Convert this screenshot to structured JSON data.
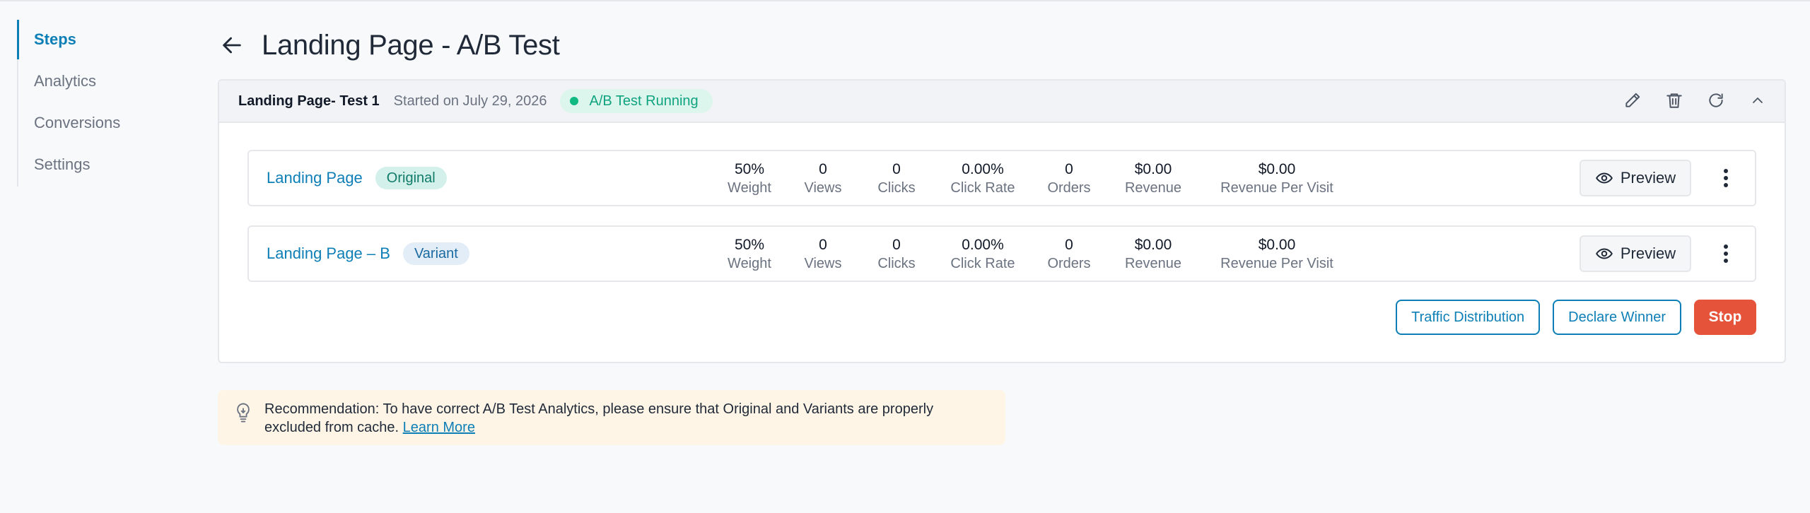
{
  "sidebar": {
    "items": [
      {
        "label": "Steps",
        "active": true
      },
      {
        "label": "Analytics",
        "active": false
      },
      {
        "label": "Conversions",
        "active": false
      },
      {
        "label": "Settings",
        "active": false
      }
    ]
  },
  "header": {
    "back_icon": "arrow-left-icon",
    "title": "Landing Page - A/B Test"
  },
  "test": {
    "name": "Landing Page- Test 1",
    "started": "Started on July 29, 2026",
    "status": "A/B Test Running",
    "status_color": "#10b981",
    "actions": [
      "edit-icon",
      "trash-icon",
      "refresh-icon",
      "chevron-up-icon"
    ]
  },
  "stat_labels": [
    "Weight",
    "Views",
    "Clicks",
    "Click Rate",
    "Orders",
    "Revenue",
    "Revenue Per Visit"
  ],
  "variants": [
    {
      "name": "Landing Page",
      "badge": "Original",
      "stats": [
        "50%",
        "0",
        "0",
        "0.00%",
        "0",
        "$0.00",
        "$0.00"
      ],
      "preview_label": "Preview"
    },
    {
      "name": "Landing Page – B",
      "badge": "Variant",
      "stats": [
        "50%",
        "0",
        "0",
        "0.00%",
        "0",
        "$0.00",
        "$0.00"
      ],
      "preview_label": "Preview"
    }
  ],
  "buttons": {
    "traffic": "Traffic Distribution",
    "declare": "Declare Winner",
    "stop": "Stop"
  },
  "colors": {
    "accent": "#0e7fb6",
    "stop": "#e5533a",
    "recommendation_bg": "#fef5e7"
  },
  "recommendation": {
    "icon": "lightbulb-icon",
    "text": "Recommendation: To have correct A/B Test Analytics, please ensure that Original and Variants are properly excluded from cache.",
    "link": "Learn More"
  }
}
